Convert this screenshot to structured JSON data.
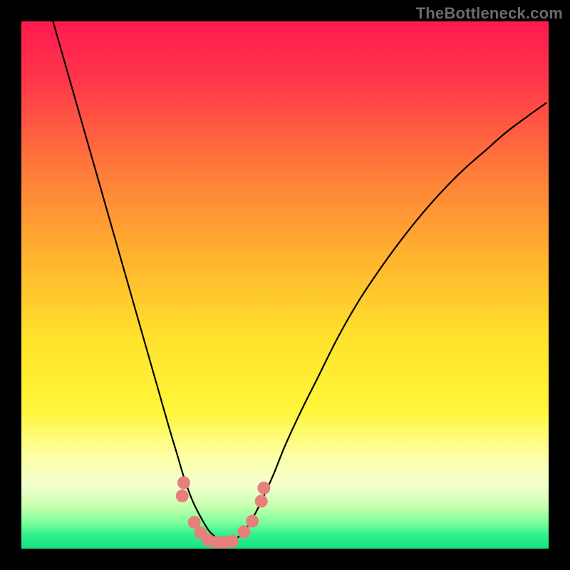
{
  "watermark": "TheBottleneck.com",
  "chart_data": {
    "type": "line",
    "title": "",
    "xlabel": "",
    "ylabel": "",
    "xlim": [
      0,
      100
    ],
    "ylim": [
      0,
      100
    ],
    "grid": false,
    "legend": false,
    "background_gradient": {
      "stops": [
        {
          "pos": 0.0,
          "color": "#ff1a4f"
        },
        {
          "pos": 0.12,
          "color": "#ff3a49"
        },
        {
          "pos": 0.28,
          "color": "#ff7a3a"
        },
        {
          "pos": 0.45,
          "color": "#ffb42e"
        },
        {
          "pos": 0.6,
          "color": "#ffe22c"
        },
        {
          "pos": 0.74,
          "color": "#fff63a"
        },
        {
          "pos": 0.82,
          "color": "#fdffa0"
        },
        {
          "pos": 0.88,
          "color": "#f3ffd0"
        },
        {
          "pos": 0.92,
          "color": "#c6ffb0"
        },
        {
          "pos": 0.95,
          "color": "#7dff9a"
        },
        {
          "pos": 0.975,
          "color": "#2fef8e"
        },
        {
          "pos": 1.0,
          "color": "#19e183"
        }
      ]
    },
    "series": [
      {
        "name": "bottleneck-curve",
        "stroke": "#000000",
        "x": [
          6,
          8,
          10,
          12,
          14,
          16,
          18,
          20,
          22,
          24,
          26,
          28,
          29.5,
          31,
          32.5,
          34,
          35.5,
          37,
          38,
          40,
          42,
          44,
          46,
          48,
          50,
          53,
          56,
          60,
          64,
          68,
          72,
          76,
          80,
          84,
          88,
          92,
          96,
          99.5
        ],
        "y": [
          100,
          93,
          86,
          79,
          72,
          65,
          58,
          51,
          44,
          37,
          30,
          23,
          18,
          13,
          9,
          6,
          3.5,
          2,
          1.2,
          1.5,
          3,
          6,
          10,
          14.5,
          19.5,
          26,
          32,
          40,
          47,
          53,
          58.5,
          63.5,
          68,
          72,
          75.5,
          79,
          82,
          84.5
        ]
      }
    ],
    "markers": [
      {
        "name": "marker-left-upper",
        "x": 30.5,
        "y": 10.0,
        "color": "#e77f7b"
      },
      {
        "name": "marker-left-upper2",
        "x": 30.8,
        "y": 12.5,
        "color": "#e77f7b"
      },
      {
        "name": "marker-left-mid",
        "x": 32.8,
        "y": 5.0,
        "color": "#e77f7b"
      },
      {
        "name": "marker-left-low",
        "x": 34.0,
        "y": 3.0,
        "color": "#e77f7b"
      },
      {
        "name": "marker-bottom-1",
        "x": 35.5,
        "y": 1.6,
        "color": "#e77f7b"
      },
      {
        "name": "marker-bottom-2",
        "x": 37.0,
        "y": 1.2,
        "color": "#e77f7b"
      },
      {
        "name": "marker-bottom-3",
        "x": 38.5,
        "y": 1.2,
        "color": "#e77f7b"
      },
      {
        "name": "marker-bottom-4",
        "x": 40.0,
        "y": 1.4,
        "color": "#e77f7b"
      },
      {
        "name": "marker-right-low",
        "x": 42.2,
        "y": 3.2,
        "color": "#e77f7b"
      },
      {
        "name": "marker-right-mid",
        "x": 43.8,
        "y": 5.2,
        "color": "#e77f7b"
      },
      {
        "name": "marker-right-upper",
        "x": 45.5,
        "y": 9.0,
        "color": "#e77f7b"
      },
      {
        "name": "marker-right-upper2",
        "x": 46.0,
        "y": 11.5,
        "color": "#e77f7b"
      }
    ]
  }
}
